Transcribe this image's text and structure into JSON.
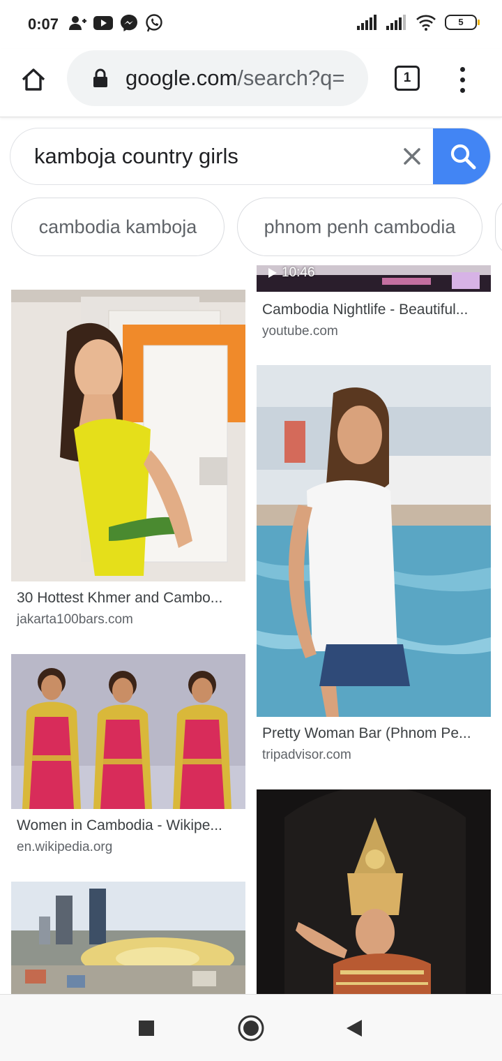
{
  "status_bar": {
    "time": "0:07",
    "left_icons": [
      "add-contact-icon",
      "youtube-icon",
      "messenger-icon",
      "whatsapp-icon"
    ],
    "right_icons": [
      "signal-icon",
      "signal-icon",
      "wifi-icon",
      "battery-icon"
    ],
    "battery_level": "5"
  },
  "toolbar": {
    "url_host": "google.com",
    "url_path": "/search?q=",
    "tab_count": "1"
  },
  "search": {
    "query": "kamboja country girls"
  },
  "chips": [
    {
      "label": "cambodia kamboja"
    },
    {
      "label": "phnom penh cambodia"
    }
  ],
  "results": {
    "left": [
      {
        "title": "30 Hottest Khmer and Cambo...",
        "domain": "jakarta100bars.com"
      },
      {
        "title": "Women in Cambodia - Wikipe...",
        "domain": "en.wikipedia.org"
      },
      {
        "title": "",
        "domain": ""
      }
    ],
    "right": [
      {
        "title": "Cambodia Nightlife - Beautiful...",
        "domain": "youtube.com",
        "duration": "10:46"
      },
      {
        "title": "Pretty Woman Bar (Phnom Pe...",
        "domain": "tripadvisor.com"
      },
      {
        "title": "",
        "domain": ""
      }
    ]
  },
  "colors": {
    "google_blue": "#4285f4",
    "chip_border": "#dadce0"
  }
}
